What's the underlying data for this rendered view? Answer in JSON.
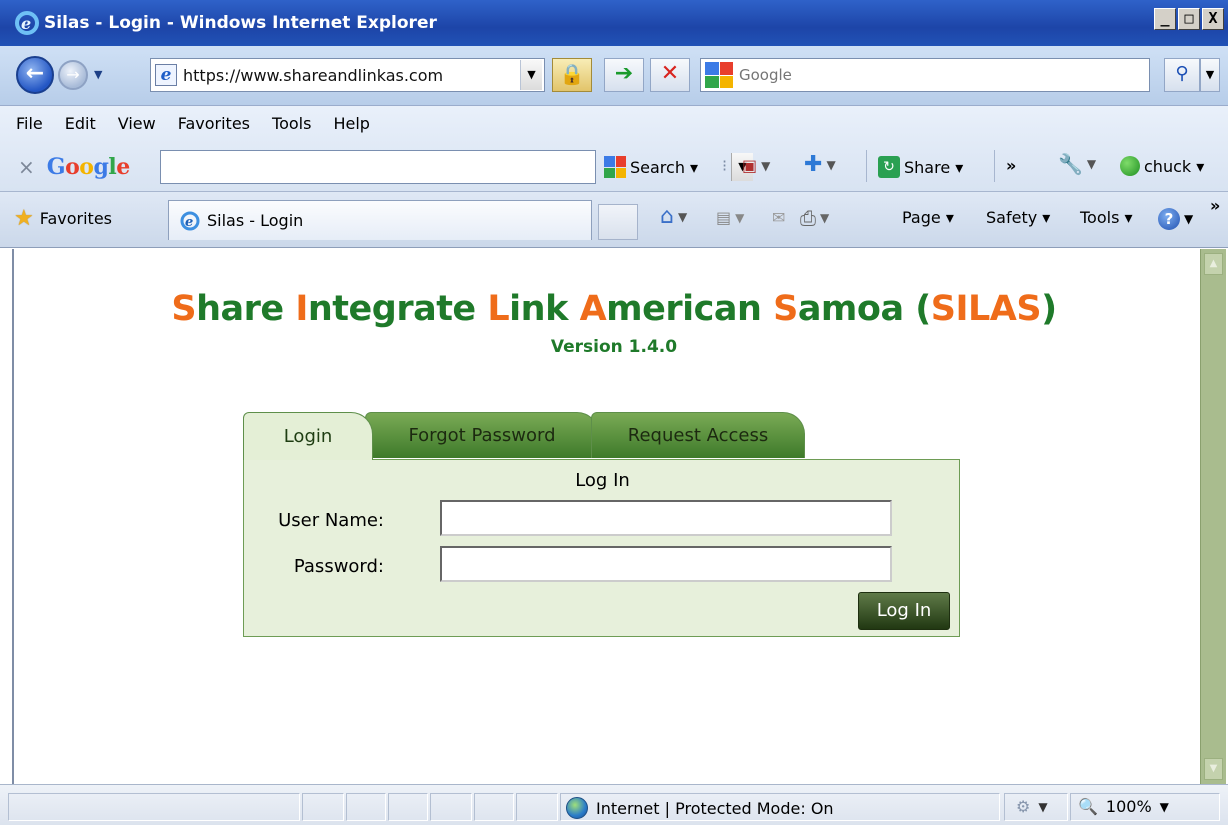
{
  "window": {
    "title": "Silas - Login - Windows Internet Explorer",
    "min": "_",
    "max": "□",
    "close": "X"
  },
  "address_bar": {
    "url": "https://www.shareandlinkas.com",
    "search_placeholder": "Google"
  },
  "menu": [
    "File",
    "Edit",
    "View",
    "Favorites",
    "Tools",
    "Help"
  ],
  "google_toolbar": {
    "logo_parts": [
      "G",
      "o",
      "o",
      "g",
      "l",
      "e"
    ],
    "search_label": "Search ▾",
    "share_label": "Share ▾",
    "more": "»",
    "user": "chuck ▾"
  },
  "favorites_bar": {
    "favorites_label": "Favorites",
    "tab_title": "Silas - Login",
    "commands": [
      "Page ▾",
      "Safety ▾",
      "Tools ▾"
    ],
    "overflow": "»"
  },
  "page": {
    "title_words": [
      {
        "initial": "S",
        "rest": "hare "
      },
      {
        "initial": "I",
        "rest": "ntegrate "
      },
      {
        "initial": "L",
        "rest": "ink "
      },
      {
        "initial": "A",
        "rest": "merican "
      },
      {
        "initial": "S",
        "rest": "amoa "
      }
    ],
    "title_paren_open": "(",
    "title_acronym": "SILAS",
    "title_paren_close": ")",
    "version": "Version 1.4.0",
    "tabs": [
      "Login",
      "Forgot Password",
      "Request Access"
    ],
    "form_heading": "Log In",
    "username_label": "User Name:",
    "password_label": "Password:",
    "username_value": "",
    "password_value": "",
    "submit_label": "Log In"
  },
  "status_bar": {
    "zone": "Internet | Protected Mode: On",
    "zoom": "100%"
  },
  "colors": {
    "accent_orange": "#ef6c1a",
    "accent_green": "#1f7a2a"
  }
}
